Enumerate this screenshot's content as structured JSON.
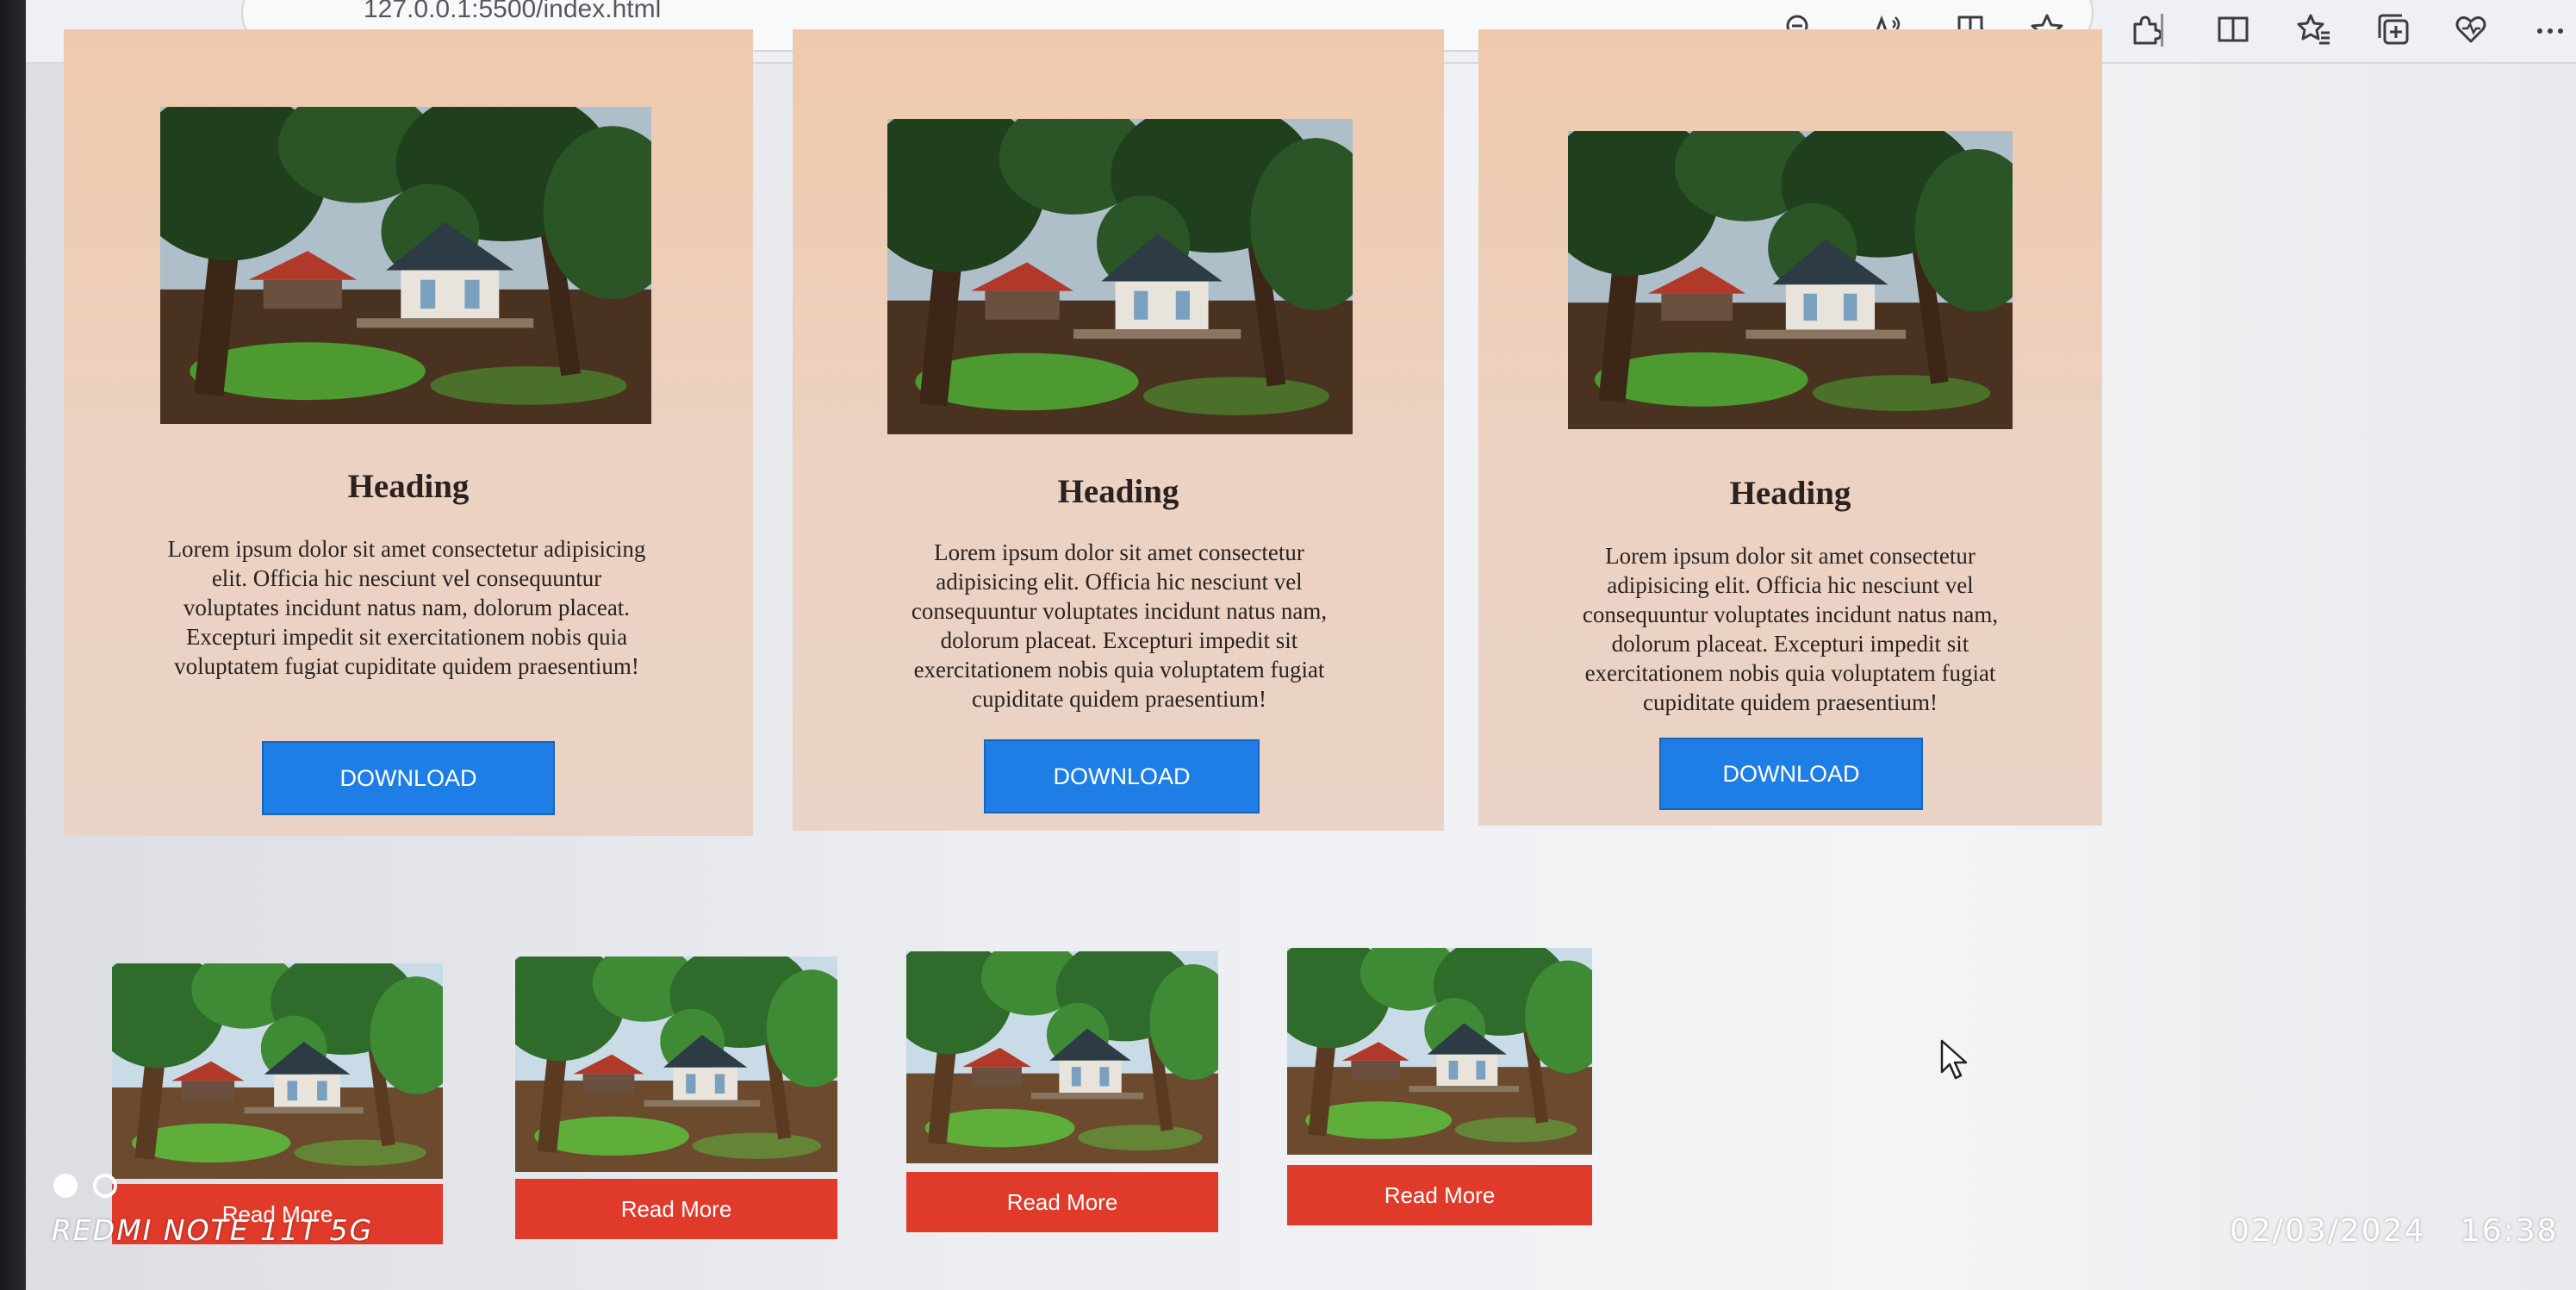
{
  "browser": {
    "url": "127.0.0.1:5500/index.html",
    "toolbar_icons": [
      "zoom-out-icon",
      "read-aloud-icon",
      "immersive-reader-icon",
      "favorite-star-icon",
      "extensions-icon",
      "split-screen-icon",
      "favorites-icon",
      "collections-icon",
      "browser-essentials-icon",
      "more-options-icon"
    ]
  },
  "cards": [
    {
      "heading": "Heading",
      "text": "Lorem ipsum dolor sit amet consectetur adipisicing elit. Officia hic nesciunt vel consequuntur voluptates incidunt natus nam, dolorum placeat. Excepturi impedit sit exercitationem nobis quia voluptatem fugiat cupiditate quidem praesentium!",
      "button": "DOWNLOAD"
    },
    {
      "heading": "Heading",
      "text": "Lorem ipsum dolor sit amet consectetur adipisicing elit. Officia hic nesciunt vel consequuntur voluptates incidunt natus nam, dolorum placeat. Excepturi impedit sit exercitationem nobis quia voluptatem fugiat cupiditate quidem praesentium!",
      "button": "DOWNLOAD"
    },
    {
      "heading": "Heading",
      "text": "Lorem ipsum dolor sit amet consectetur adipisicing elit. Officia hic nesciunt vel consequuntur voluptates incidunt natus nam, dolorum placeat. Excepturi impedit sit exercitationem nobis quia voluptatem fugiat cupiditate quidem praesentium!",
      "button": "DOWNLOAD"
    }
  ],
  "thumbnails": [
    {
      "button": "Read More"
    },
    {
      "button": "Read More"
    },
    {
      "button": "Read More"
    },
    {
      "button": "Read More"
    }
  ],
  "camera_overlay": {
    "model": "REDMI NOTE 11T 5G",
    "date": "02/03/2024",
    "time": "16:38"
  },
  "colors": {
    "card_background": "#ecd2c2",
    "download_button": "#1e7ee6",
    "read_more_button": "#e03a2a"
  }
}
